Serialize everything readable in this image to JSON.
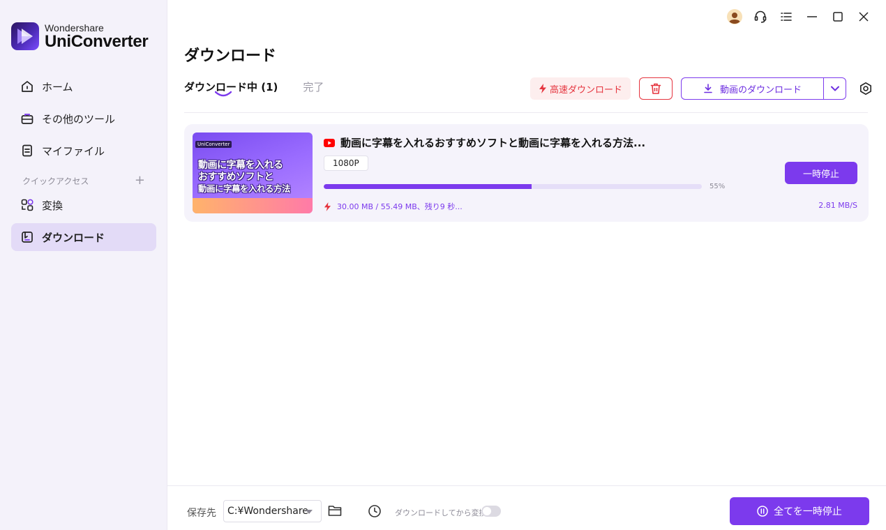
{
  "brand": {
    "top": "Wondershare",
    "name": "UniConverter"
  },
  "sidebar": {
    "items": [
      {
        "label": "ホーム",
        "icon": "home-icon"
      },
      {
        "label": "その他のツール",
        "icon": "toolbox-icon"
      },
      {
        "label": "マイファイル",
        "icon": "file-icon"
      }
    ],
    "section_label": "クイックアクセス",
    "quick": [
      {
        "label": "変換",
        "icon": "convert-icon"
      },
      {
        "label": "ダウンロード",
        "icon": "download-icon",
        "active": true
      }
    ]
  },
  "page": {
    "title": "ダウンロード"
  },
  "tabs": {
    "active": "ダウンロード中 (1)",
    "inactive": "完了"
  },
  "toolbar": {
    "fast_label": "高速ダウンロード",
    "download_label": "動画のダウンロード"
  },
  "item": {
    "title": "動画に字幕を入れるおすすめソフトと動画に字幕を入れる方法...",
    "resolution": "1080P",
    "progress": 55,
    "progress_label": "55%",
    "stats": "30.00 MB / 55.49 MB、残り9 秒...",
    "speed": "2.81 MB/S",
    "pause_label": "一時停止",
    "thumb_badge": "UniConverter",
    "thumb_lines": [
      "動画に字幕を入れる",
      "おすすめソフトと",
      "動画に字幕を入れる方法"
    ]
  },
  "bottom": {
    "save_label": "保存先",
    "path": "C:¥Wondershare",
    "convert_label": "ダウンロードしてから変換:",
    "pause_all_label": "全てを一時停止"
  },
  "colors": {
    "accent": "#7c3aed",
    "danger": "#e5343e",
    "sidebar_bg": "#f4f2fa"
  }
}
